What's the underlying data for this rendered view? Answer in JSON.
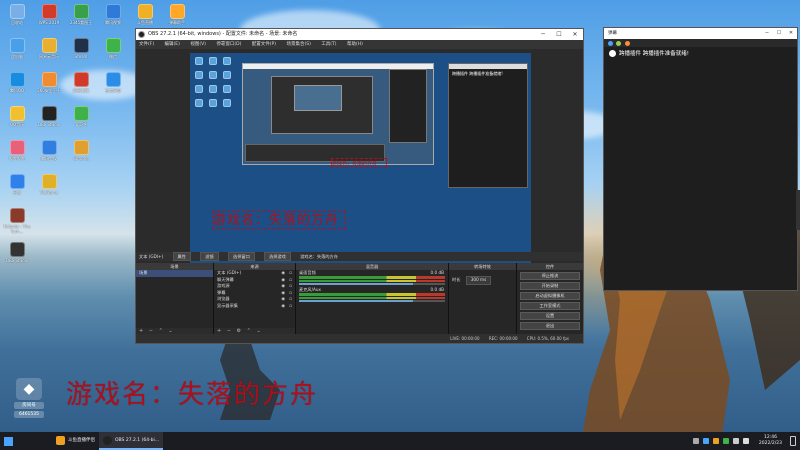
{
  "desktop": {
    "icons": [
      {
        "label": "回收站",
        "color": "#7aaee6"
      },
      {
        "label": "WPS 2019",
        "color": "#d23a2a"
      },
      {
        "label": "2345看图王",
        "color": "#38a04a"
      },
      {
        "label": "腾讯视频",
        "color": "#2e7ad8"
      },
      {
        "label": "斗鱼直播",
        "color": "#f0b025"
      },
      {
        "label": "弹幕助手",
        "color": "#ffa726"
      },
      {
        "label": "此电脑",
        "color": "#4aa0e8"
      },
      {
        "label": "网易云音乐",
        "color": "#e8b030"
      },
      {
        "label": "Steam",
        "color": "#20304a"
      },
      {
        "label": "微信",
        "color": "#3db34a"
      },
      {
        "label": "腾讯QQ",
        "color": "#1a8ce0"
      },
      {
        "label": "360安全卫士",
        "color": "#f08c30"
      },
      {
        "label": "网易邮箱",
        "color": "#d03a2a"
      },
      {
        "label": "百度网盘",
        "color": "#2c8de8"
      },
      {
        "label": "QQ音乐",
        "color": "#f0c030"
      },
      {
        "label": "OBS Studio",
        "color": "#222222"
      },
      {
        "label": "爱奇艺",
        "color": "#3fb04a"
      },
      {
        "label": "哔哩哔哩",
        "color": "#e8607a"
      },
      {
        "label": "腾讯会议",
        "color": "#2f7ee0"
      },
      {
        "label": "Chrome",
        "color": "#e0a030"
      },
      {
        "label": "迅雷",
        "color": "#2f80ea"
      },
      {
        "label": "WeGame",
        "color": "#e0b028"
      },
      {
        "label": "Nobody - The Turn...",
        "color": "#8a3a2a"
      },
      {
        "label": "OBS Studio",
        "color": "#333333"
      }
    ],
    "watermark": {
      "room_label": "房间号",
      "room_id": "6461535"
    }
  },
  "obs": {
    "title": "OBS 27.2.1 (64-bit, windows) - 配置文件: 未命名 - 场景: 未命名",
    "menu": [
      "文件(F)",
      "编辑(E)",
      "视图(V)",
      "停靠窗口(D)",
      "配置文件(P)",
      "场景集合(S)",
      "工具(T)",
      "帮助(H)"
    ],
    "preview_overlay_text": "游戏名：失落的方舟",
    "infobar": {
      "source": "文本 (GDI+)",
      "props": "属性",
      "filters": "滤镜",
      "select_window": "选择窗口",
      "select_scene": "选择游戏",
      "text_label": "游戏名：失落的方舟"
    },
    "scenes": {
      "title": "场景",
      "items": [
        "场景"
      ]
    },
    "sources": {
      "title": "来源",
      "items": [
        "文本 (GDI+)",
        "聊天弹幕",
        "游戏源",
        "弹幕",
        "浏览器",
        "显示器采集"
      ]
    },
    "mixer": {
      "title": "混音器",
      "tracks": [
        {
          "name": "桌面音频",
          "db": "0.0 dB"
        },
        {
          "name": "麦克风/Aux",
          "db": "0.0 dB"
        }
      ]
    },
    "transitions": {
      "title": "转场特效",
      "duration_label": "时长",
      "duration_value": "300 ms"
    },
    "controls": {
      "title": "控件",
      "buttons": [
        "停止推流",
        "开始录制",
        "启动虚拟摄像机",
        "工作室模式",
        "设置",
        "退出"
      ]
    },
    "status": {
      "live": "LIVE: 00:00:00",
      "rec": "REC: 00:00:00",
      "cpu": "CPU: 0.5%, 60.00 fps"
    }
  },
  "chat": {
    "title": "弹幕",
    "message": "跨播插件 跨播插件准备就绪!"
  },
  "overlay": {
    "game_name": "游戏名：失落的方舟"
  },
  "taskbar": {
    "apps": [
      {
        "label": "斗鱼直播伴侣",
        "color": "#f0a020"
      },
      {
        "label": "OBS 27.2.1 (64-bi...",
        "color": "#222222"
      }
    ],
    "time": "12:46",
    "date": "2022/2/23"
  }
}
